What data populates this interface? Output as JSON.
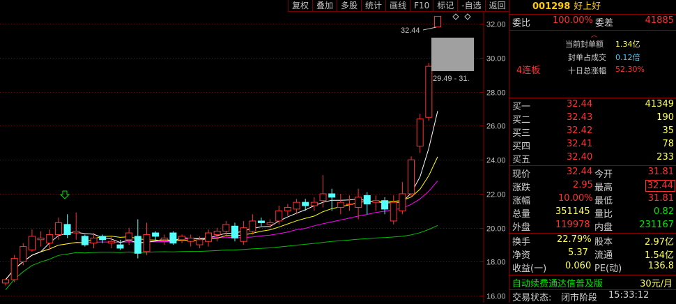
{
  "toolbar": {
    "items": [
      "复权",
      "叠加",
      "多股",
      "统计",
      "画线",
      "F10",
      "标记",
      "-自选",
      "返回"
    ]
  },
  "stock": {
    "code": "001298",
    "name": "好上好"
  },
  "weibi": {
    "label": "委比",
    "value": "100.00%",
    "diff_label": "委差",
    "diff_value": "41885"
  },
  "seal": {
    "lianban": "4连板",
    "current_seal_label": "当前封单额",
    "current_seal_value": "1.34亿",
    "seal_ratio_label": "封单占成交",
    "seal_ratio_value": "0.12倍",
    "ten_day_label": "十日总涨幅",
    "ten_day_value": "52.30%"
  },
  "bids": [
    {
      "label": "买一",
      "price": "32.44",
      "vol": "41349"
    },
    {
      "label": "买二",
      "price": "32.43",
      "vol": "190"
    },
    {
      "label": "买三",
      "price": "32.42",
      "vol": "35"
    },
    {
      "label": "买四",
      "price": "32.41",
      "vol": "78"
    },
    {
      "label": "买五",
      "price": "32.40",
      "vol": "233"
    }
  ],
  "quote": {
    "xianjia_label": "现价",
    "xianjia": "32.44",
    "jinkai_label": "今开",
    "jinkai": "31.81",
    "zhangdie_label": "涨跌",
    "zhangdie": "2.95",
    "zuigao_label": "最高",
    "zuigao": "32.44",
    "zhangfu_label": "涨幅",
    "zhangfu": "10.00%",
    "zuidi_label": "最低",
    "zuidi": "31.81",
    "zongliang_label": "总量",
    "zongliang": "351145",
    "liangbi_label": "量比",
    "liangbi": "0.82",
    "waipan_label": "外盘",
    "waipan": "119978",
    "neipan_label": "内盘",
    "neipan": "231167"
  },
  "fundamentals": {
    "huanshou_label": "换手",
    "huanshou": "22.79%",
    "guben_label": "股本",
    "guben": "2.97亿",
    "jingzi_label": "净资",
    "jingzi": "5.37",
    "liutong_label": "流通",
    "liutong": "1.54亿",
    "shouyi_label": "收益(一)",
    "shouyi": "0.060",
    "pe_label": "PE(动)",
    "pe": "136.8"
  },
  "footer": {
    "promo": "自动续费通达信普及版",
    "promo_price": "30元/月",
    "status_label": "交易状态:",
    "status_value": "闭市阶段",
    "time": "15:33:12"
  },
  "chart": {
    "y_ticks": [
      "32.00",
      "30.00",
      "28.00",
      "26.00",
      "24.00",
      "22.00",
      "20.00",
      "18.00",
      "16.00"
    ],
    "high_marker": "32.44",
    "range_label": "29.49 - 31.",
    "colors": {
      "up": "#ff3232",
      "down": "#54ffff",
      "ma5": "#ffffff",
      "ma10": "#ffff00",
      "ma20": "#ff00ff",
      "ma60": "#00c000"
    }
  },
  "chart_data": {
    "type": "candlestick",
    "ylim": [
      15.6,
      33.4
    ],
    "y_ticks": [
      32,
      30,
      28,
      26,
      24,
      22,
      20,
      18,
      16
    ],
    "candles": [
      [
        16.75,
        16.95,
        16.6,
        17.0
      ],
      [
        16.95,
        18.2,
        16.8,
        18.4
      ],
      [
        18.0,
        18.9,
        17.8,
        19.1
      ],
      [
        18.7,
        19.5,
        18.6,
        19.9
      ],
      [
        19.3,
        19.4,
        18.9,
        19.8
      ],
      [
        19.1,
        19.6,
        18.7,
        19.9
      ],
      [
        19.6,
        20.3,
        19.3,
        20.6
      ],
      [
        20.2,
        19.6,
        19.4,
        20.8
      ],
      [
        19.7,
        19.8,
        19.3,
        20.9
      ],
      [
        19.5,
        19.0,
        18.9,
        19.6
      ],
      [
        19.1,
        19.4,
        18.8,
        19.7
      ],
      [
        19.5,
        19.3,
        19.1,
        19.6
      ],
      [
        19.1,
        19.2,
        18.8,
        19.5
      ],
      [
        19.0,
        18.8,
        18.7,
        19.3
      ],
      [
        19.3,
        19.7,
        19.0,
        20.0
      ],
      [
        19.5,
        18.5,
        18.2,
        20.5
      ],
      [
        18.6,
        19.6,
        18.4,
        20.3
      ],
      [
        19.7,
        19.5,
        19.2,
        19.8
      ],
      [
        19.3,
        19.4,
        19.0,
        19.6
      ],
      [
        19.7,
        19.1,
        19.0,
        19.8
      ],
      [
        19.3,
        19.5,
        19.1,
        19.6
      ],
      [
        19.2,
        19.4,
        18.9,
        19.6
      ],
      [
        19.0,
        19.3,
        18.8,
        19.5
      ],
      [
        19.2,
        19.7,
        18.9,
        19.9
      ],
      [
        19.6,
        19.8,
        19.2,
        20.0
      ],
      [
        19.8,
        20.2,
        19.5,
        20.4
      ],
      [
        20.1,
        19.4,
        19.2,
        20.3
      ],
      [
        19.2,
        20.0,
        19.0,
        20.4
      ],
      [
        19.8,
        20.4,
        19.6,
        20.8
      ],
      [
        20.4,
        20.3,
        20.1,
        20.6
      ],
      [
        20.2,
        20.3,
        20.0,
        20.5
      ],
      [
        20.4,
        21.0,
        20.2,
        21.3
      ],
      [
        21.0,
        21.2,
        20.7,
        21.4
      ],
      [
        21.1,
        21.5,
        20.8,
        21.7
      ],
      [
        21.5,
        21.3,
        21.0,
        21.7
      ],
      [
        21.3,
        21.5,
        21.0,
        21.8
      ],
      [
        21.6,
        22.0,
        21.2,
        23.1
      ],
      [
        22.0,
        21.8,
        21.0,
        22.3
      ],
      [
        21.2,
        21.5,
        20.8,
        22.0
      ],
      [
        21.4,
        21.4,
        21.0,
        21.9
      ],
      [
        21.2,
        21.8,
        20.5,
        22.3
      ],
      [
        21.9,
        21.4,
        20.8,
        22.1
      ],
      [
        21.5,
        21.6,
        21.0,
        21.9
      ],
      [
        21.6,
        21.1,
        20.8,
        21.8
      ],
      [
        20.4,
        21.5,
        20.2,
        21.9
      ],
      [
        21.0,
        22.0,
        20.8,
        22.7
      ],
      [
        22.0,
        24.0,
        21.8,
        24.2
      ],
      [
        24.8,
        26.4,
        24.4,
        26.7
      ],
      [
        26.5,
        29.5,
        26.3,
        29.7
      ],
      [
        31.81,
        32.44,
        31.81,
        32.44
      ]
    ]
  }
}
